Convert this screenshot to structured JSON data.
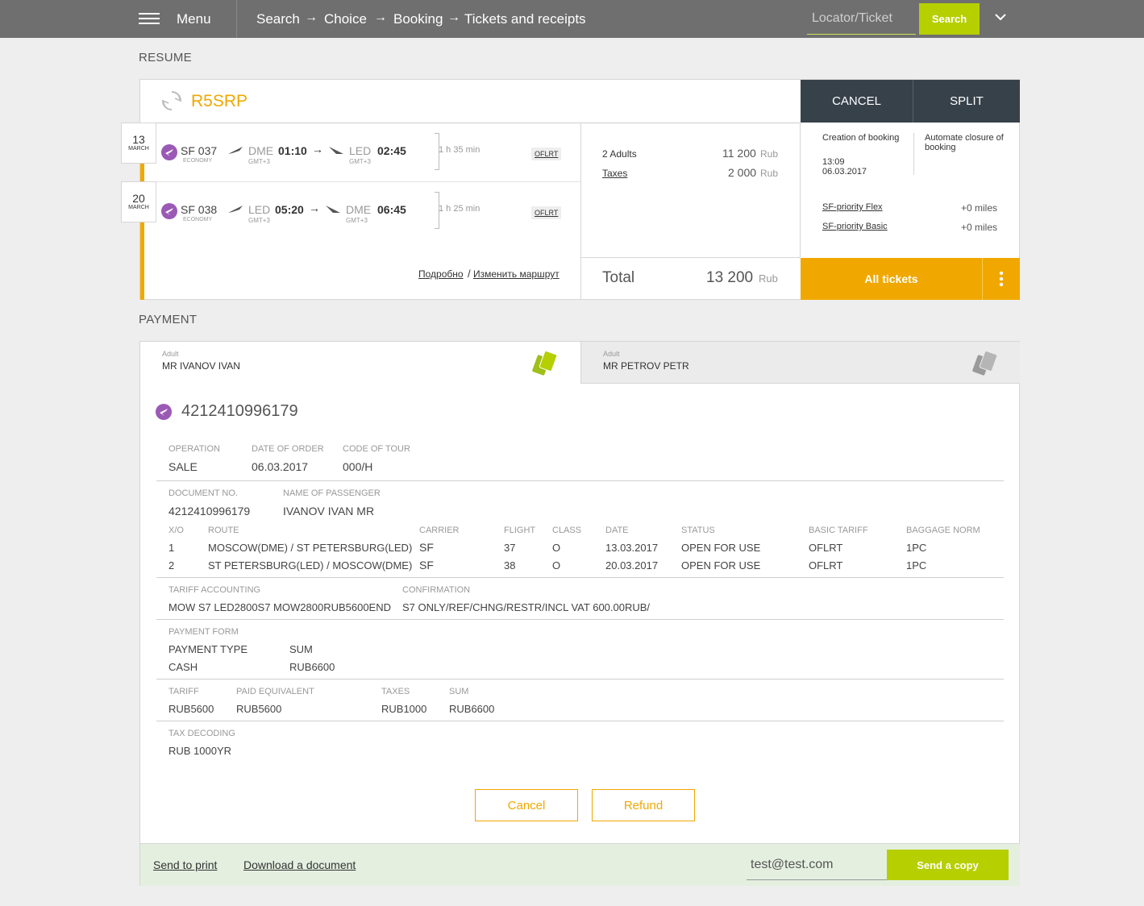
{
  "header": {
    "menu_label": "Menu",
    "breadcrumbs": [
      "Search",
      "Choice",
      "Booking",
      "Tickets and receipts"
    ],
    "locator_placeholder": "Locator/Ticket",
    "search_label": "Search"
  },
  "resume": {
    "section_title": "RESUME",
    "booking_code": "R5SRP",
    "cancel_label": "CANCEL",
    "split_label": "SPLIT",
    "flights": [
      {
        "day": "13",
        "month": "MARCH",
        "flight": "SF 037",
        "cabin": "ECONOMY",
        "from": "DME",
        "from_tz": "GMT+3",
        "dep": "01:10",
        "to": "LED",
        "to_tz": "GMT+3",
        "arr": "02:45",
        "duration": "1 h 35 min",
        "fare": "OFLRT"
      },
      {
        "day": "20",
        "month": "MARCH",
        "flight": "SF 038",
        "cabin": "ECONOMY",
        "from": "LED",
        "from_tz": "GMT+3",
        "dep": "05:20",
        "to": "DME",
        "to_tz": "GMT+3",
        "arr": "06:45",
        "duration": "1 h 25 min",
        "fare": "OFLRT"
      }
    ],
    "details_link": "Подробно",
    "change_route_link": "Изменить маршрут",
    "price": {
      "adults_label": "2 Adults",
      "adults_value": "11 200",
      "currency": "Rub",
      "taxes_label": "Taxes",
      "taxes_value": "2 000",
      "total_label": "Total",
      "total_value": "13 200"
    },
    "creation_label": "Creation of booking",
    "creation_time": "13:09",
    "creation_date": "06.03.2017",
    "automate_label": "Automate closure of booking",
    "priority": [
      {
        "name": "SF-priority Flex",
        "value": "+0 miles"
      },
      {
        "name": "SF-priority Basic",
        "value": "+0 miles"
      }
    ],
    "all_tickets_label": "All tickets"
  },
  "payment": {
    "section_title": "PAYMENT",
    "passengers": [
      {
        "type": "Adult",
        "name": "MR IVANOV IVAN"
      },
      {
        "type": "Adult",
        "name": "MR PETROV PETR"
      }
    ],
    "ticket_number": "4212410996179",
    "operation_label": "OPERATION",
    "operation_value": "SALE",
    "order_date_label": "DATE OF ORDER",
    "order_date_value": "06.03.2017",
    "tour_code_label": "CODE OF TOUR",
    "tour_code_value": "000/H",
    "doc_no_label": "DOCUMENT NO.",
    "doc_no_value": "4212410996179",
    "pax_name_label": "NAME OF PASSENGER",
    "pax_name_value": "IVANOV IVAN MR",
    "segment_headers": [
      "X/O",
      "ROUTE",
      "CARRIER",
      "FLIGHT",
      "CLASS",
      "DATE",
      "STATUS",
      "BASIC TARIFF",
      "BAGGAGE NORM"
    ],
    "segments": [
      [
        "1",
        "MOSCOW(DME) / ST PETERSBURG(LED)",
        "SF",
        "37",
        "O",
        "13.03.2017",
        "OPEN FOR USE",
        "OFLRT",
        "1PC"
      ],
      [
        "2",
        "ST PETERSBURG(LED) / MOSCOW(DME)",
        "SF",
        "38",
        "O",
        "20.03.2017",
        "OPEN FOR USE",
        "OFLRT",
        "1PC"
      ]
    ],
    "tariff_acc_label": "TARIFF ACCOUNTING",
    "tariff_acc_value": "MOW S7 LED2800S7 MOW2800RUB5600END",
    "confirmation_label": "CONFIRMATION",
    "confirmation_value": "S7 ONLY/REF/CHNG/RESTR/INCL VAT 600.00RUB/",
    "payment_form_label": "PAYMENT FORM",
    "payment_type_label": "PAYMENT TYPE",
    "payment_type_value": "CASH",
    "sum_label": "SUM",
    "sum_value": "RUB6600",
    "tariff_label": "TARIFF",
    "tariff_value": "RUB5600",
    "paid_eq_label": "PAID EQUIVALENT",
    "paid_eq_value": "RUB5600",
    "taxes_label": "TAXES",
    "taxes_value": "RUB1000",
    "sum2_label": "SUM",
    "sum2_value": "RUB6600",
    "tax_decoding_label": "TAX DECODING",
    "tax_decoding_value": "RUB 1000YR",
    "cancel_label": "Cancel",
    "refund_label": "Refund"
  },
  "footer": {
    "print_label": "Send to print",
    "download_label": "Download a document",
    "email_value": "test@test.com",
    "send_copy_label": "Send a copy"
  },
  "colors": {
    "accent_orange": "#f0a800",
    "accent_green": "#b6cf00",
    "dark": "#37414a",
    "purple": "#9b59b6"
  }
}
